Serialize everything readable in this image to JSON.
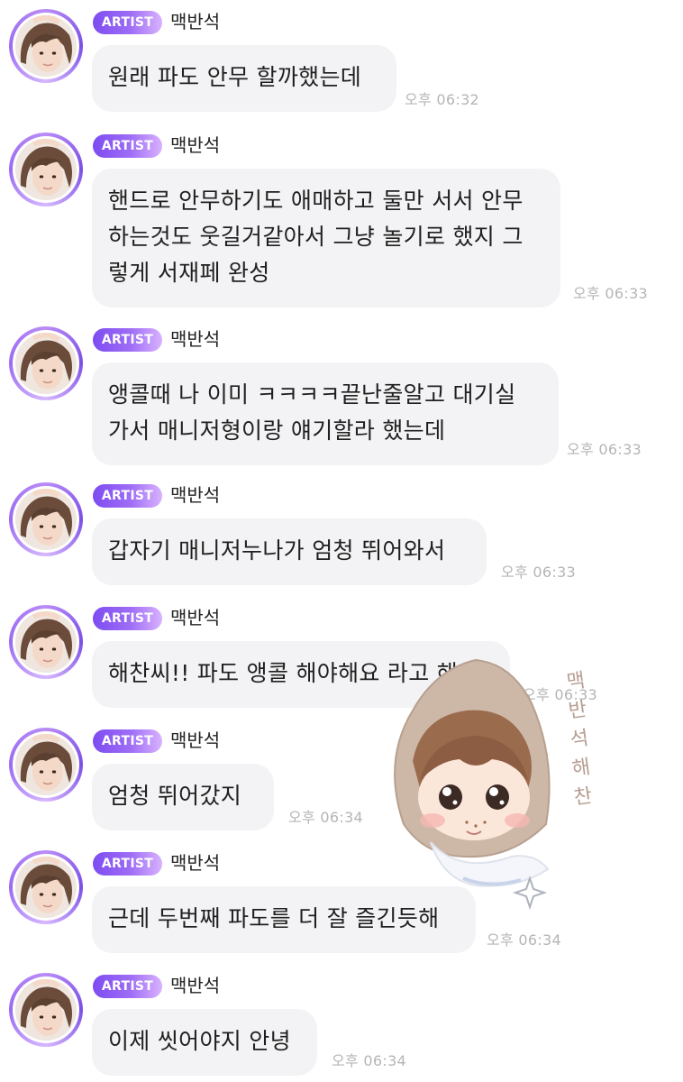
{
  "messages": [
    {
      "badge": "ARTIST",
      "sender": "맥반석",
      "text": "원래 파도 안무 할까했는데",
      "time": "오후 06:32"
    },
    {
      "badge": "ARTIST",
      "sender": "맥반석",
      "text": "핸드로 안무하기도 애매하고 둘만 서서 안무\n하는것도 웃길거같아서 그냥 놀기로 했지 그\n렇게 서재페 완성",
      "time": "오후 06:33"
    },
    {
      "badge": "ARTIST",
      "sender": "맥반석",
      "text": "앵콜때 나 이미 ㅋㅋㅋㅋ끝난줄알고 대기실\n가서 매니저형이랑 얘기할라 했는데",
      "time": "오후 06:33"
    },
    {
      "badge": "ARTIST",
      "sender": "맥반석",
      "text": "갑자기 매니저누나가 엄청 뛰어와서",
      "time": "오후 06:33"
    },
    {
      "badge": "ARTIST",
      "sender": "맥반석",
      "text": "해찬씨!! 파도 앵콜 해야해요 라고 해서",
      "time": "오후 06:33"
    },
    {
      "badge": "ARTIST",
      "sender": "맥반석",
      "text": "엄청 뛰어갔지",
      "time": "오후 06:34"
    },
    {
      "badge": "ARTIST",
      "sender": "맥반석",
      "text": "근데 두번째 파도를 더 잘 즐긴듯해",
      "time": "오후 06:34"
    },
    {
      "badge": "ARTIST",
      "sender": "맥반석",
      "text": "이제 씻어야지 안녕",
      "time": "오후 06:34"
    }
  ],
  "sticker": {
    "caption": "맥반석해찬",
    "icon": "sparkle-icon"
  },
  "colors": {
    "badge_start": "#7d4cf2",
    "badge_end": "#d9b2ff",
    "bubble_bg": "#f3f3f5",
    "time_text": "#b5b5b5"
  }
}
